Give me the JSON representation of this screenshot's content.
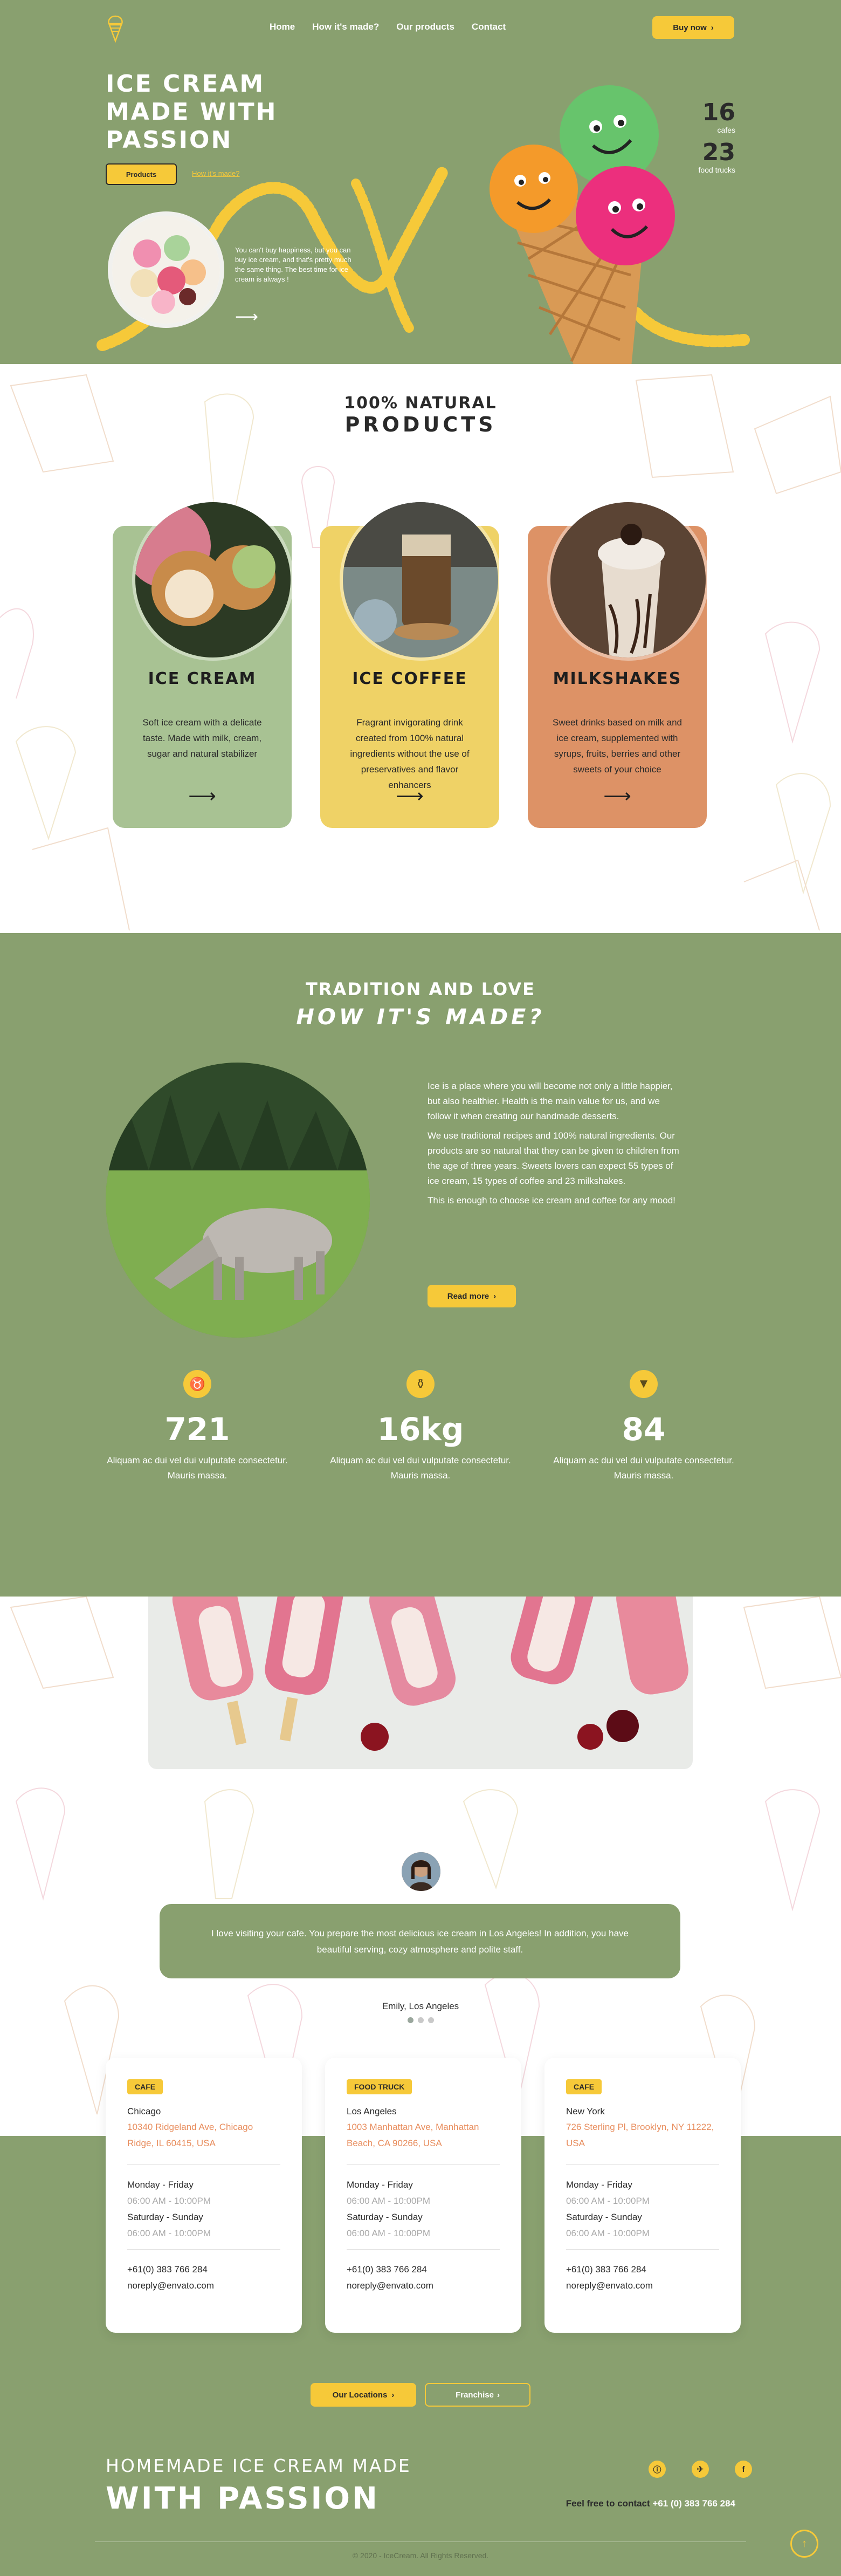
{
  "nav": {
    "links": [
      "Home",
      "How it's made?",
      "Our products",
      "Contact"
    ],
    "buy_now": "Buy now",
    "buy_now_arrow": "›"
  },
  "hero": {
    "title": "ICE CREAM MADE WITH PASSION",
    "products_button": "Products",
    "how_link": "How it's made?",
    "text": "You can't buy happiness, but you can buy ice cream, and that's pretty much the same thing. The best time for ice cream is always !",
    "arrow": "⟶",
    "stats": [
      {
        "num": "16",
        "label": "cafes"
      },
      {
        "num": "23",
        "label": "food trucks"
      }
    ]
  },
  "products": {
    "subtitle": "100% NATURAL",
    "title": "PRODUCTS",
    "items": [
      {
        "name": "ICE CREAM",
        "desc": "Soft ice cream with a delicate taste. Made with milk, cream, sugar and natural stabilizer",
        "color": "#a8c293",
        "arrow": "⟶"
      },
      {
        "name": "ICE COFFEE",
        "desc": "Fragrant invigorating drink created from 100% natural ingredients without the use of preservatives and flavor enhancers",
        "color": "#efd266",
        "arrow": "⟶"
      },
      {
        "name": "MILKSHAKES",
        "desc": "Sweet drinks based on milk and ice cream, supplemented with syrups, fruits, berries and other sweets of your choice",
        "color": "#dd9266",
        "arrow": "⟶"
      }
    ]
  },
  "how": {
    "subtitle": "TRADITION AND LOVE",
    "title": "HOW IT'S MADE?",
    "paragraphs": [
      "Ice is a place where you will become not only a little happier, but also healthier. Health is the main value for us, and we follow it when creating our handmade desserts.",
      "We use traditional recipes and 100% natural ingredients. Our products are so natural that they can be given to children from the age of three years. Sweets lovers can expect 55 types of ice cream, 15 types of coffee and 23 milkshakes.",
      "This is enough to choose ice cream and coffee for any mood!"
    ],
    "read_more": "Read more",
    "read_more_arrow": "›",
    "counters": [
      {
        "icon": "cow-icon",
        "num": "721",
        "desc": "Aliquam ac dui vel dui vulputate consectetur. Mauris massa."
      },
      {
        "icon": "milk-jar-icon",
        "num": "16kg",
        "desc": "Aliquam ac dui vel dui vulputate consectetur. Mauris massa."
      },
      {
        "icon": "ice-cream-icon",
        "num": "84",
        "desc": "Aliquam ac dui vel dui vulputate consectetur. Mauris massa."
      }
    ]
  },
  "testimonial": {
    "quote": "I love visiting your cafe. You prepare the most delicious ice cream in Los Angeles! In addition, you have beautiful serving, cozy atmosphere and polite staff.",
    "author": "Emily, Los Angeles"
  },
  "locations": {
    "cards": [
      {
        "tag": "CAFE",
        "city": "Chicago",
        "address": "10340 Ridgeland Ave, Chicago Ridge, IL 60415, USA",
        "day1": "Monday - Friday",
        "hours1": "06:00 AM - 10:00PM",
        "day2": "Saturday - Sunday",
        "hours2": "06:00 AM - 10:00PM",
        "phone": "+61(0) 383 766 284",
        "email": "noreply@envato.com"
      },
      {
        "tag": "FOOD TRUCK",
        "city": "Los Angeles",
        "address": "1003 Manhattan Ave, Manhattan Beach, CA 90266, USA",
        "day1": "Monday - Friday",
        "hours1": "06:00 AM - 10:00PM",
        "day2": "Saturday - Sunday",
        "hours2": "06:00 AM - 10:00PM",
        "phone": "+61(0) 383 766 284",
        "email": "noreply@envato.com"
      },
      {
        "tag": "CAFE",
        "city": "New York",
        "address": "726 Sterling Pl, Brooklyn, NY 11222, USA",
        "day1": "Monday - Friday",
        "hours1": "06:00 AM - 10:00PM",
        "day2": "Saturday - Sunday",
        "hours2": "06:00 AM - 10:00PM",
        "phone": "+61(0) 383 766 284",
        "email": "noreply@envato.com"
      }
    ],
    "our_locations": "Our Locations",
    "franchise": "Franchise",
    "arrow": "›"
  },
  "footer": {
    "line1": "HOMEMADE ICE CREAM MADE",
    "line2": "WITH PASSION",
    "feel_free": "Feel free to contact",
    "phone": "+61 (0) 383 766 284",
    "socials": [
      "ⓘ",
      "✈",
      "f"
    ],
    "copyright": "© 2020 - IceCream. All Rights Reserved.",
    "scroll_up": "↑"
  },
  "colors": {
    "green": "#89a06f",
    "yellow": "#f6c939",
    "orange_text": "#e88d5d"
  }
}
